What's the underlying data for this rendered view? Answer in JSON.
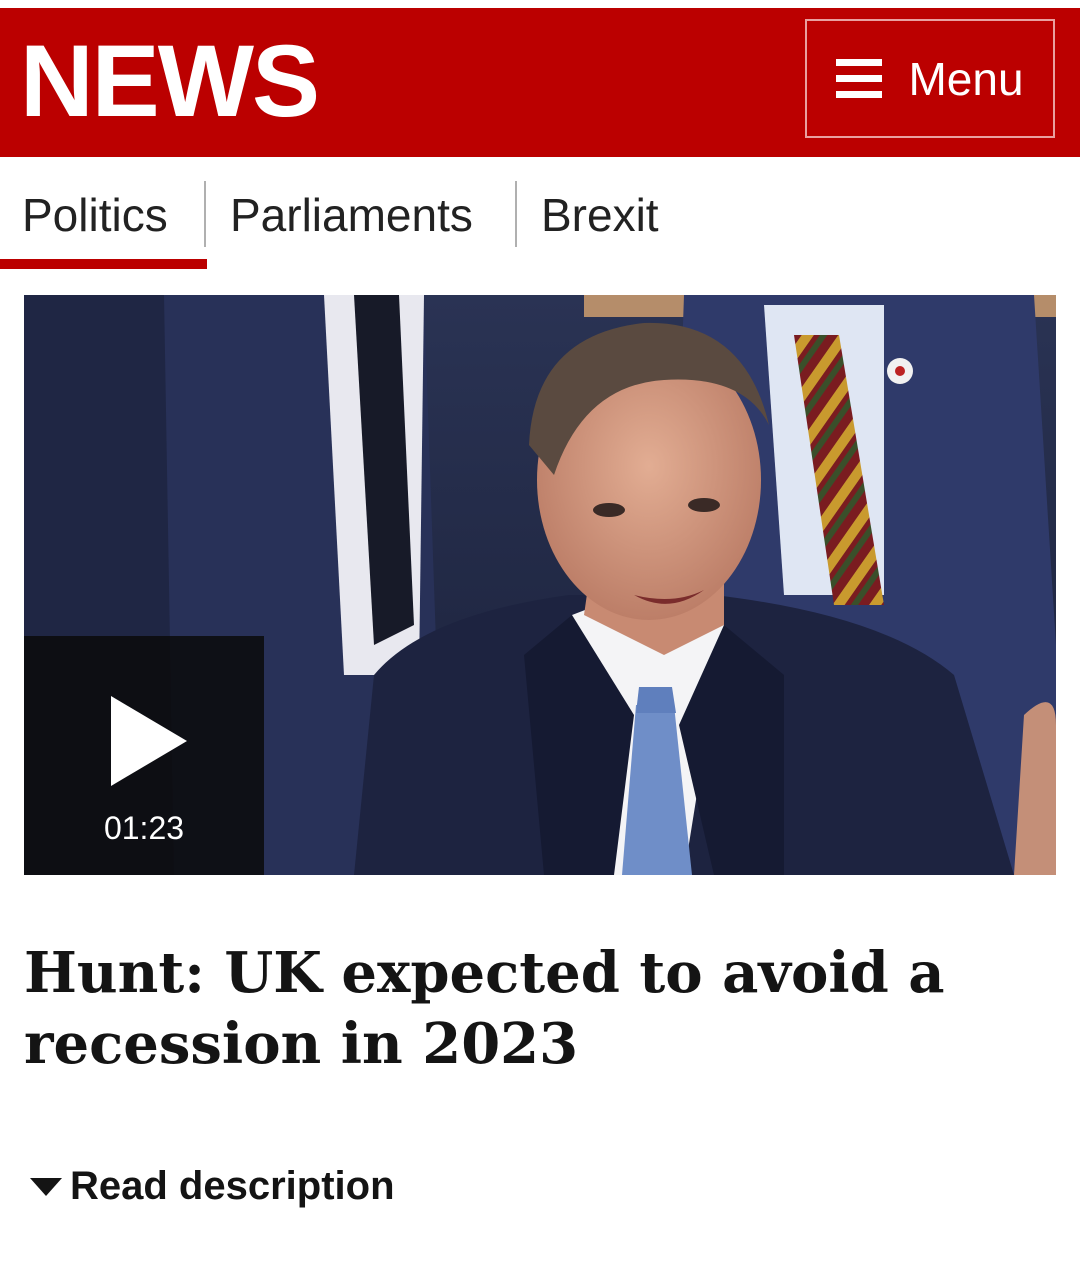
{
  "header": {
    "logo_text": "NEWS",
    "menu_label": "Menu",
    "brand_color": "#bb0000"
  },
  "nav": {
    "items": [
      {
        "label": "Politics",
        "active": true
      },
      {
        "label": "Parliaments",
        "active": false
      },
      {
        "label": "Brexit",
        "active": false
      }
    ]
  },
  "video": {
    "duration": "01:23",
    "play_icon": "play-icon"
  },
  "article": {
    "headline": "Hunt: UK expected to avoid a recession in 2023",
    "read_description_label": "Read description",
    "caret_icon": "caret-down-icon"
  }
}
